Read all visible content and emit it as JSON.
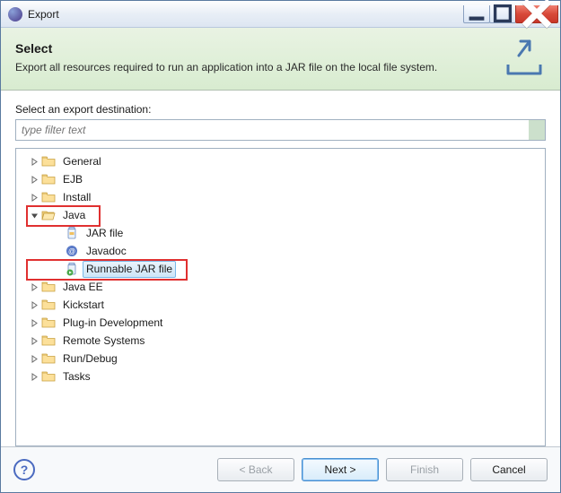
{
  "window": {
    "title": "Export"
  },
  "banner": {
    "title": "Select",
    "description": "Export all resources required to run an application into a JAR file on the local file system."
  },
  "body": {
    "section_label": "Select an export destination:",
    "filter_placeholder": "type filter text"
  },
  "tree": {
    "items": [
      {
        "label": "General",
        "icon": "folder",
        "expanded": false,
        "depth": 0
      },
      {
        "label": "EJB",
        "icon": "folder",
        "expanded": false,
        "depth": 0
      },
      {
        "label": "Install",
        "icon": "folder",
        "expanded": false,
        "depth": 0
      },
      {
        "label": "Java",
        "icon": "folder",
        "expanded": true,
        "depth": 0,
        "highlight": true
      },
      {
        "label": "JAR file",
        "icon": "jar",
        "depth": 1
      },
      {
        "label": "Javadoc",
        "icon": "javadoc",
        "depth": 1
      },
      {
        "label": "Runnable JAR file",
        "icon": "runjar",
        "depth": 1,
        "selected": true,
        "highlight": true
      },
      {
        "label": "Java EE",
        "icon": "folder",
        "expanded": false,
        "depth": 0
      },
      {
        "label": "Kickstart",
        "icon": "folder",
        "expanded": false,
        "depth": 0
      },
      {
        "label": "Plug-in Development",
        "icon": "folder",
        "expanded": false,
        "depth": 0
      },
      {
        "label": "Remote Systems",
        "icon": "folder",
        "expanded": false,
        "depth": 0
      },
      {
        "label": "Run/Debug",
        "icon": "folder",
        "expanded": false,
        "depth": 0
      },
      {
        "label": "Tasks",
        "icon": "folder",
        "expanded": false,
        "depth": 0
      }
    ]
  },
  "footer": {
    "help": "?",
    "back": "< Back",
    "next": "Next >",
    "finish": "Finish",
    "cancel": "Cancel",
    "back_enabled": false,
    "next_enabled": true,
    "finish_enabled": false,
    "cancel_enabled": true
  }
}
